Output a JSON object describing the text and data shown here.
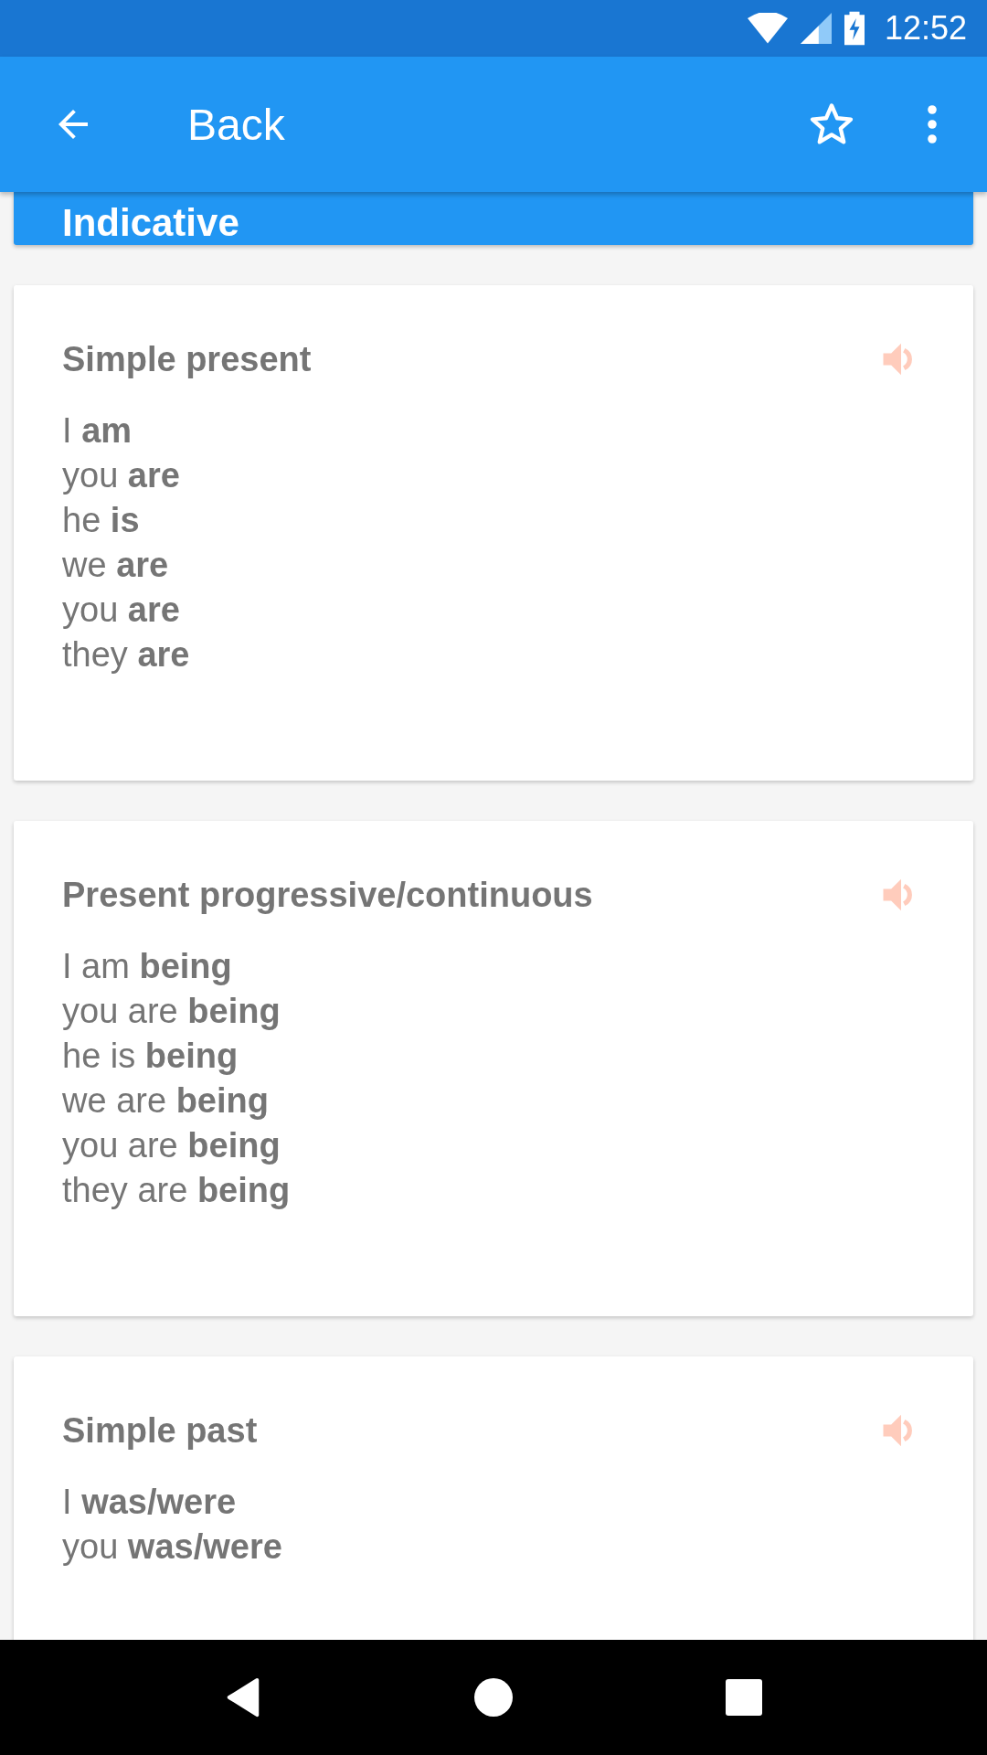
{
  "status_bar": {
    "time": "12:52"
  },
  "app_bar": {
    "title": "Back"
  },
  "section": {
    "title": "Indicative"
  },
  "cards": [
    {
      "title": "Simple present",
      "lines": [
        "I **am**",
        "you **are**",
        "he **is**",
        "we **are**",
        "you **are**",
        "they **are**"
      ]
    },
    {
      "title": "Present progressive/continuous",
      "lines": [
        "I am **being**",
        "you are **being**",
        "he is **being**",
        "we are **being**",
        "you are **being**",
        "they are **being**"
      ]
    },
    {
      "title": "Simple past",
      "lines": [
        "I **was/were**",
        "you **was/were**"
      ]
    }
  ]
}
